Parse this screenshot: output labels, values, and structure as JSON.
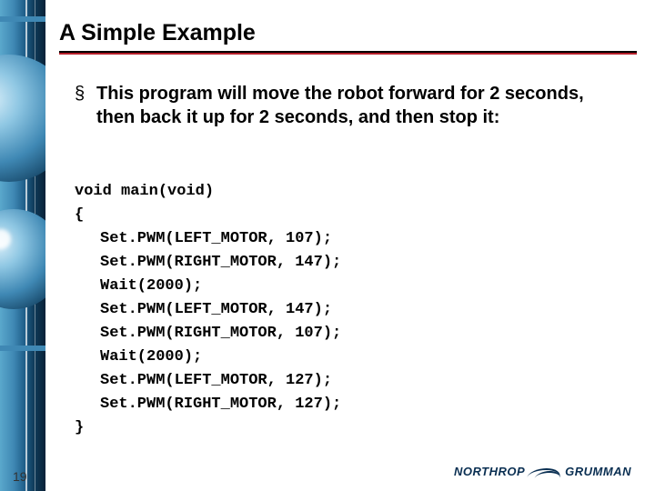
{
  "title": "A Simple Example",
  "bullet": {
    "symbol": "§",
    "text": "This program will move the robot forward for 2 seconds, then back it up for 2 seconds, and then stop it:"
  },
  "code": {
    "line0": "void main(void)",
    "line1": "{",
    "line2": "Set.PWM(LEFT_MOTOR, 107);",
    "line3": "Set.PWM(RIGHT_MOTOR, 147);",
    "line4": "Wait(2000);",
    "line5": "Set.PWM(LEFT_MOTOR, 147);",
    "line6": "Set.PWM(RIGHT_MOTOR, 107);",
    "line7": "Wait(2000);",
    "line8": "Set.PWM(LEFT_MOTOR, 127);",
    "line9": "Set.PWM(RIGHT_MOTOR, 127);",
    "line10": "}"
  },
  "page_number": "19",
  "logo": {
    "name1": "NORTHROP",
    "name2": "GRUMMAN"
  }
}
